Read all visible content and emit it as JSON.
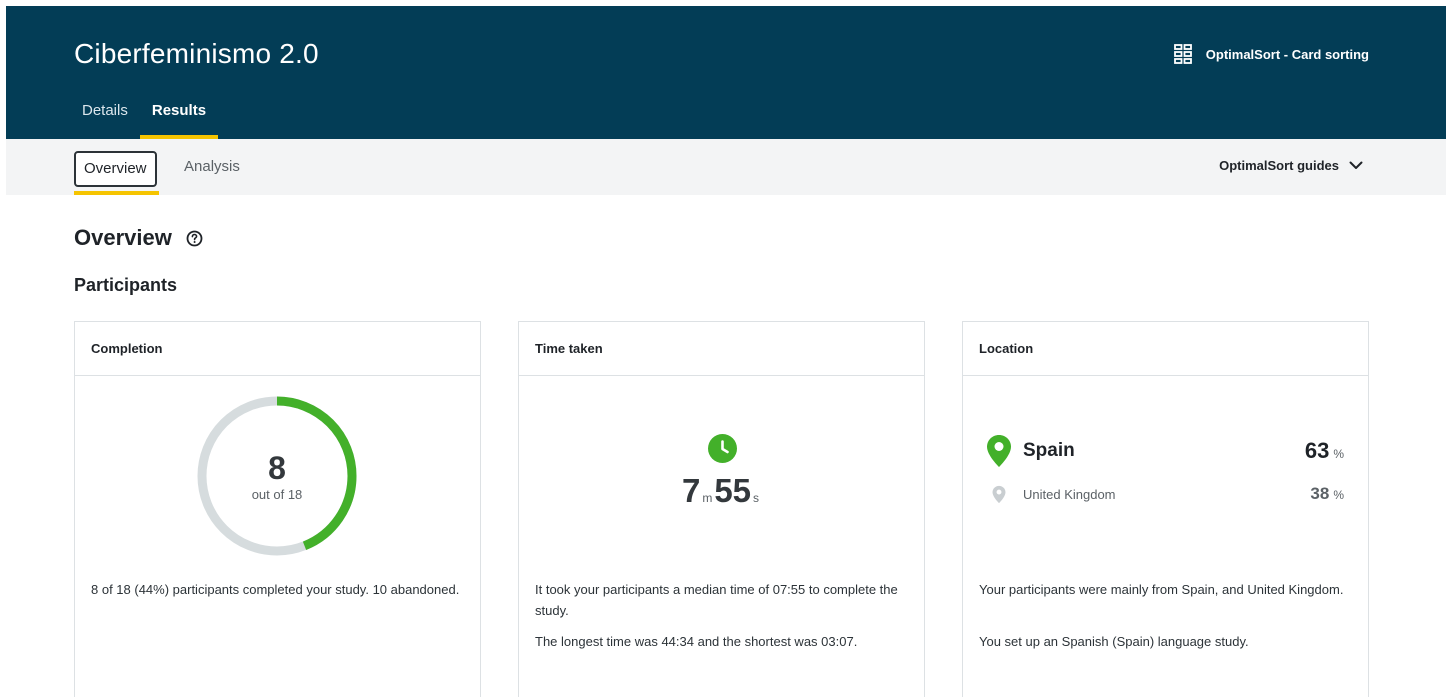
{
  "header": {
    "title": "Ciberfeminismo 2.0",
    "study_type": "OptimalSort - Card sorting",
    "study_icon": "card-grid-icon",
    "tabs": [
      {
        "label": "Details",
        "active": false
      },
      {
        "label": "Results",
        "active": true
      }
    ]
  },
  "subnav": {
    "tabs": [
      {
        "label": "Overview",
        "active": true
      },
      {
        "label": "Analysis",
        "active": false
      }
    ],
    "guides_label": "OptimalSort guides",
    "guides_icon": "chevron-down-icon"
  },
  "main": {
    "title": "Overview",
    "help_icon": "help-circle-icon",
    "section_title": "Participants"
  },
  "cards": {
    "completion": {
      "title": "Completion",
      "completed": "8",
      "total_label": "out of 18",
      "progress_fraction": 0.44,
      "description": "8 of 18 (44%) participants completed your study. 10 abandoned."
    },
    "time": {
      "title": "Time taken",
      "icon": "clock-icon",
      "minutes": "7",
      "minutes_unit": "m",
      "seconds": "55",
      "seconds_unit": "s",
      "description_1": "It took your participants a median time of 07:55 to complete the study.",
      "description_2": "The longest time was 44:34 and the shortest was 03:07."
    },
    "location": {
      "title": "Location",
      "rows": [
        {
          "country": "Spain",
          "percent": "63",
          "unit": "%",
          "icon": "map-pin-icon"
        },
        {
          "country": "United Kingdom",
          "percent": "38",
          "unit": "%",
          "icon": "map-pin-icon"
        }
      ],
      "description_1": "Your participants were mainly from Spain, and United Kingdom.",
      "description_2": "You set up an Spanish (Spain) language study."
    }
  },
  "colors": {
    "header_bg": "#033d56",
    "accent_yellow": "#f5c400",
    "success_green": "#43b02a",
    "ring_track": "#d6dcde"
  }
}
